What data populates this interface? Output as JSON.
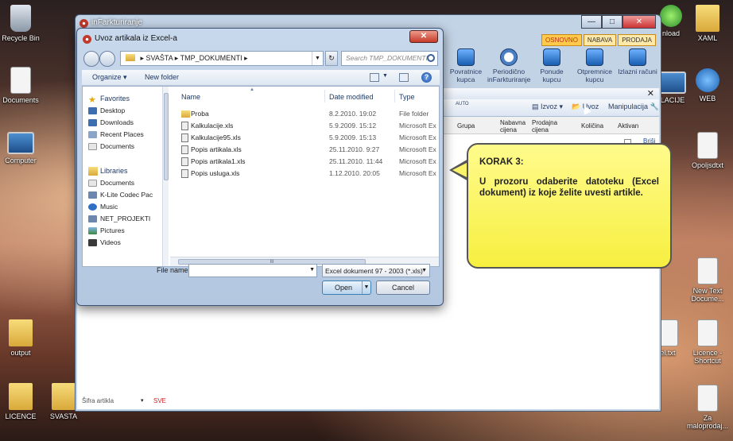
{
  "desktop": {
    "icons": [
      {
        "label": "Recycle Bin"
      },
      {
        "label": "Documents"
      },
      {
        "label": "Computer"
      },
      {
        "label": "output"
      },
      {
        "label": "LICENCE"
      },
      {
        "label": "SVASTA"
      },
      {
        "label": "XAML"
      },
      {
        "label": "nload"
      },
      {
        "label": "WEB"
      },
      {
        "label": "LACIJE"
      },
      {
        "label": "Opoljsdtxt"
      },
      {
        "label": "New Text Docume..."
      },
      {
        "label": "el.txt"
      },
      {
        "label": "Licence - Shortcut"
      },
      {
        "label": "Za maloprodaj..."
      }
    ]
  },
  "app": {
    "title": "inFarkturiranje",
    "window_controls": {
      "minimize": "—",
      "maximize": "□",
      "close": "✕"
    },
    "mode_tabs": [
      "OSNOVNO",
      "NABAVA",
      "PRODAJA"
    ],
    "ribbon": [
      {
        "label": "Povratnice kupca"
      },
      {
        "label": "Periodično inFarkturiranje"
      },
      {
        "label": "Ponude kupcu"
      },
      {
        "label": "Otpremnice kupcu"
      },
      {
        "label": "Izlazni računi"
      }
    ],
    "subbar_close": "✕",
    "toolbar": {
      "auto_label": "AUTO",
      "izvoz": "Izvoz",
      "uvoz": "Uvoz",
      "manipulacija": "Manipulacija"
    },
    "grid_columns": [
      "Grupa",
      "Nabavna cijena",
      "Prodajna cijena",
      "Količina",
      "Aktivan"
    ],
    "row_link": "Briši",
    "filter": {
      "label": "Šifra artikla",
      "value": "SVE"
    }
  },
  "dialog": {
    "title": "Uvoz artikala iz Excel-a",
    "close_label": "✕",
    "breadcrumb": [
      "SVAŠTA",
      "TMP_DOKUMENTI"
    ],
    "search_placeholder": "Search TMP_DOKUMENTI",
    "commands": {
      "organize": "Organize ▾",
      "new_folder": "New folder"
    },
    "nav": {
      "favorites_header": "Favorites",
      "favorites": [
        "Desktop",
        "Downloads",
        "Recent Places",
        "Documents"
      ],
      "libraries_header": "Libraries",
      "libraries": [
        "Documents",
        "K-Lite Codec Pac",
        "Music",
        "NET_PROJEKTI",
        "Pictures",
        "Videos"
      ]
    },
    "columns": {
      "name": "Name",
      "date": "Date modified",
      "type": "Type"
    },
    "files": [
      {
        "name": "Proba",
        "date": "8.2.2010. 19:02",
        "type": "File folder",
        "is_dir": true
      },
      {
        "name": "Kalkulacije.xls",
        "date": "5.9.2009. 15:12",
        "type": "Microsoft Ex",
        "is_dir": false
      },
      {
        "name": "Kalkulacije95.xls",
        "date": "5.9.2009. 15:13",
        "type": "Microsoft Ex",
        "is_dir": false
      },
      {
        "name": "Popis artikala.xls",
        "date": "25.11.2010. 9:27",
        "type": "Microsoft Ex",
        "is_dir": false
      },
      {
        "name": "Popis artikala1.xls",
        "date": "25.11.2010. 11:44",
        "type": "Microsoft Ex",
        "is_dir": false
      },
      {
        "name": "Popis usluga.xls",
        "date": "1.12.2010. 20:05",
        "type": "Microsoft Ex",
        "is_dir": false
      }
    ],
    "file_name_label": "File name:",
    "file_name_value": "",
    "file_type": "Excel dokument 97 - 2003 (*.xls)",
    "open_label": "Open",
    "cancel_label": "Cancel"
  },
  "callout": {
    "step": "KORAK 3:",
    "text": "U prozoru odaberite datoteku (Excel dokument) iz koje želite uvesti artikle."
  }
}
